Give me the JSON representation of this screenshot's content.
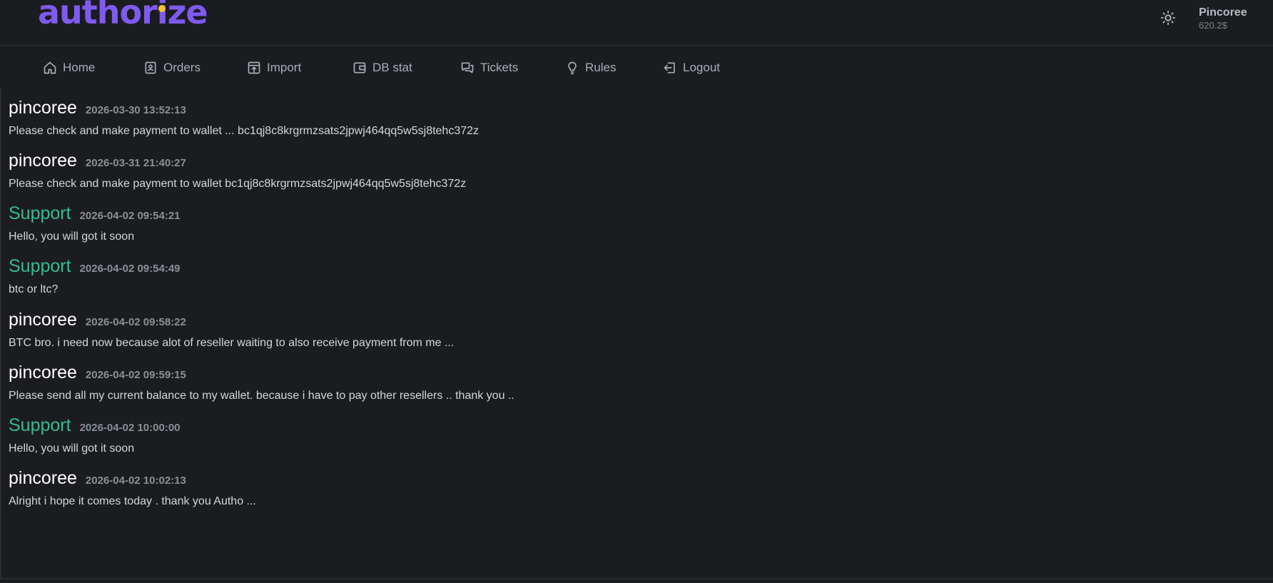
{
  "brand": {
    "logo_text": "authorize",
    "accent": "#7f5af0",
    "dot_color": "#f7c52e"
  },
  "header": {
    "theme_icon": "sun-icon",
    "user_name": "Pincoree",
    "balance": "620.2$"
  },
  "nav": {
    "items": [
      {
        "label": "Home",
        "icon": "home-icon"
      },
      {
        "label": "Orders",
        "icon": "orders-icon"
      },
      {
        "label": "Import",
        "icon": "import-icon"
      },
      {
        "label": "DB stat",
        "icon": "wallet-icon"
      },
      {
        "label": "Tickets",
        "icon": "chat-icon"
      },
      {
        "label": "Rules",
        "icon": "lightbulb-icon"
      },
      {
        "label": "Logout",
        "icon": "logout-icon"
      }
    ]
  },
  "messages": [
    {
      "author": "pincoree",
      "time": "2026-03-30 13:52:13",
      "text": "Please check and make payment to wallet ... bc1qj8c8krgrmzsats2jpwj464qq5w5sj8tehc372z"
    },
    {
      "author": "pincoree",
      "time": "2026-03-31 21:40:27",
      "text": "Please check and make payment to wallet bc1qj8c8krgrmzsats2jpwj464qq5w5sj8tehc372z"
    },
    {
      "author": "Support",
      "time": "2026-04-02 09:54:21",
      "text": "Hello, you will got it soon"
    },
    {
      "author": "Support",
      "time": "2026-04-02 09:54:49",
      "text": "btc or ltc?"
    },
    {
      "author": "pincoree",
      "time": "2026-04-02 09:58:22",
      "text": "BTC bro. i need now because alot of reseller waiting to also receive payment from me ..."
    },
    {
      "author": "pincoree",
      "time": "2026-04-02 09:59:15",
      "text": "Please send all my current balance to my wallet. because i have to pay other resellers .. thank you .."
    },
    {
      "author": "Support",
      "time": "2026-04-02 10:00:00",
      "text": "Hello, you will got it soon"
    },
    {
      "author": "pincoree",
      "time": "2026-04-02 10:02:13",
      "text": "Alright i hope it comes today . thank you Autho ..."
    }
  ],
  "colors": {
    "support_author": "#2fbf8f",
    "user_author": "#ffffff",
    "background": "#1b1c1f"
  }
}
